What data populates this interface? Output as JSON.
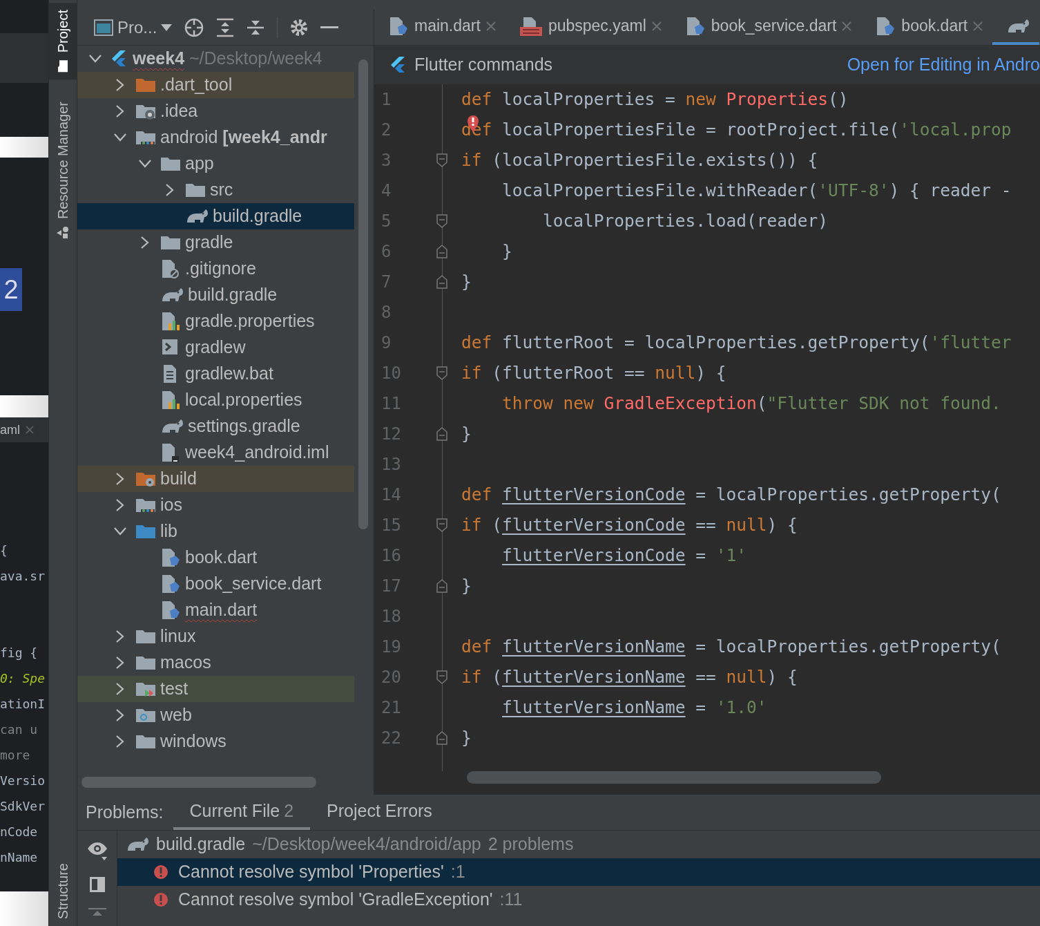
{
  "background_window": {
    "badge": "2",
    "tab": {
      "label": "aml",
      "closable": true
    },
    "code_blocks": [
      [
        {
          "text": "{",
          "kind": "plain"
        },
        {
          "text": "ava.sr",
          "kind": "plain"
        }
      ],
      [
        {
          "text": "fig {",
          "kind": "plain"
        },
        {
          "text": "0: Spe",
          "kind": "todo"
        },
        {
          "text": "ationI",
          "kind": "plain"
        },
        {
          "text": "can u",
          "kind": "comment"
        },
        {
          "text": "more",
          "kind": "comment"
        },
        {
          "text": "Versio",
          "kind": "plain"
        },
        {
          "text": "SdkVer",
          "kind": "plain"
        },
        {
          "text": "nCode",
          "kind": "plain"
        },
        {
          "text": "nName",
          "kind": "plain"
        }
      ]
    ]
  },
  "tool_strip": {
    "items": [
      {
        "label": "Project",
        "kind": "folder",
        "selected": true
      },
      {
        "label": "Resource Manager",
        "kind": "shapes",
        "selected": false
      }
    ],
    "bottom_items": [
      {
        "label": "Structure",
        "selected": false
      }
    ]
  },
  "project_panel": {
    "view_selector": "Pro...",
    "tree": [
      {
        "label": "**week4** ~/Desktop/week4",
        "kind": "flutter",
        "expanded": true,
        "error": true,
        "selected": false,
        "children": [
          {
            "label": ".dart_tool",
            "kind": "folder-orange",
            "expanded": false,
            "color": "#4a463b",
            "selected": false
          },
          {
            "label": ".idea",
            "kind": "folder-gear",
            "expanded": false,
            "selected": false
          },
          {
            "label": "android **[week4_andr**",
            "kind": "folder-module",
            "expanded": true,
            "selected": false,
            "children": [
              {
                "label": "app",
                "kind": "folder",
                "expanded": true,
                "selected": false,
                "children": [
                  {
                    "label": "src",
                    "kind": "folder",
                    "expanded": false,
                    "selected": false
                  },
                  {
                    "label": "build.gradle",
                    "kind": "gradle",
                    "selected": true
                  }
                ]
              },
              {
                "label": "gradle",
                "kind": "folder",
                "expanded": false,
                "selected": false
              },
              {
                "label": ".gitignore",
                "kind": "gitignore",
                "selected": false
              },
              {
                "label": "build.gradle",
                "kind": "gradle",
                "selected": false
              },
              {
                "label": "gradle.properties",
                "kind": "properties",
                "selected": false
              },
              {
                "label": "gradlew",
                "kind": "script",
                "selected": false
              },
              {
                "label": "gradlew.bat",
                "kind": "text",
                "selected": false
              },
              {
                "label": "local.properties",
                "kind": "properties",
                "selected": false
              },
              {
                "label": "settings.gradle",
                "kind": "gradle",
                "selected": false
              },
              {
                "label": "week4_android.iml",
                "kind": "iml",
                "selected": false
              }
            ]
          },
          {
            "label": "build",
            "kind": "folder-orange-gear",
            "expanded": false,
            "color": "#4a463b",
            "selected": false
          },
          {
            "label": "ios",
            "kind": "folder-module",
            "expanded": false,
            "selected": false
          },
          {
            "label": "lib",
            "kind": "folder-blue",
            "expanded": true,
            "selected": false,
            "children": [
              {
                "label": "book.dart",
                "kind": "dart",
                "selected": false
              },
              {
                "label": "book_service.dart",
                "kind": "dart",
                "selected": false
              },
              {
                "label": "main.dart",
                "kind": "dart",
                "error": true,
                "selected": false
              }
            ]
          },
          {
            "label": "linux",
            "kind": "folder",
            "expanded": false,
            "selected": false
          },
          {
            "label": "macos",
            "kind": "folder",
            "expanded": false,
            "selected": false
          },
          {
            "label": "test",
            "kind": "folder-test",
            "expanded": false,
            "color": "#444c3f",
            "selected": false
          },
          {
            "label": "web",
            "kind": "folder-web",
            "expanded": false,
            "selected": false
          },
          {
            "label": "windows",
            "kind": "folder",
            "expanded": false,
            "selected": false
          }
        ]
      }
    ]
  },
  "editor": {
    "tabs": [
      {
        "label": "main.dart",
        "kind": "dart",
        "selected": false
      },
      {
        "label": "pubspec.yaml",
        "kind": "yaml",
        "selected": false
      },
      {
        "label": "book_service.dart",
        "kind": "dart",
        "selected": false
      },
      {
        "label": "book.dart",
        "kind": "dart",
        "selected": false
      },
      {
        "kind": "gradle",
        "selected": true
      }
    ],
    "banner": {
      "title": "Flutter commands",
      "link": "Open for Editing in Andro"
    },
    "lines": [
      {
        "number": "1",
        "tokens": [
          {
            "text": "def",
            "kind": "keyword"
          },
          {
            "text": " localProperties = ",
            "kind": "plain"
          },
          {
            "text": "new ",
            "kind": "keyword"
          },
          {
            "text": "Properties",
            "kind": "unresolved"
          },
          {
            "text": "()",
            "kind": "plain"
          }
        ]
      },
      {
        "number": "2",
        "error": true,
        "tokens": [
          {
            "text": "def",
            "kind": "keyword"
          },
          {
            "text": " localPropertiesFile = rootProject.file(",
            "kind": "plain"
          },
          {
            "text": "'local.prop",
            "kind": "string"
          }
        ]
      },
      {
        "number": "3",
        "fold_start": true,
        "tokens": [
          {
            "text": "if",
            "kind": "keyword"
          },
          {
            "text": " (localPropertiesFile.exists()) {",
            "kind": "plain"
          }
        ]
      },
      {
        "number": "4",
        "tokens": [
          {
            "text": "    localPropertiesFile.withReader(",
            "kind": "plain"
          },
          {
            "text": "'UTF-8'",
            "kind": "string"
          },
          {
            "text": ") { reader -",
            "kind": "plain"
          }
        ]
      },
      {
        "number": "5",
        "fold_start": true,
        "tokens": [
          {
            "text": "        localProperties.load(reader)",
            "kind": "plain"
          }
        ]
      },
      {
        "number": "6",
        "fold_end": true,
        "tokens": [
          {
            "text": "    }",
            "kind": "plain"
          }
        ]
      },
      {
        "number": "7",
        "fold_end": true,
        "tokens": [
          {
            "text": "}",
            "kind": "plain"
          }
        ]
      },
      {
        "number": "8"
      },
      {
        "number": "9",
        "tokens": [
          {
            "text": "def",
            "kind": "keyword"
          },
          {
            "text": " flutterRoot = localProperties.getProperty(",
            "kind": "plain"
          },
          {
            "text": "'flutter",
            "kind": "string"
          }
        ]
      },
      {
        "number": "10",
        "fold_start": true,
        "tokens": [
          {
            "text": "if",
            "kind": "keyword"
          },
          {
            "text": " (flutterRoot == ",
            "kind": "plain"
          },
          {
            "text": "null",
            "kind": "keyword"
          },
          {
            "text": ") {",
            "kind": "plain"
          }
        ]
      },
      {
        "number": "11",
        "tokens": [
          {
            "text": "    throw new ",
            "kind": "keyword"
          },
          {
            "text": "GradleException",
            "kind": "unresolved"
          },
          {
            "text": "(",
            "kind": "plain"
          },
          {
            "text": "\"Flutter SDK not found.",
            "kind": "string"
          }
        ]
      },
      {
        "number": "12",
        "fold_end": true,
        "tokens": [
          {
            "text": "}",
            "kind": "plain"
          }
        ]
      },
      {
        "number": "13"
      },
      {
        "number": "14",
        "tokens": [
          {
            "text": "def ",
            "kind": "keyword"
          },
          {
            "text": "flutterVersionCode",
            "kind": "field"
          },
          {
            "text": " = localProperties.getProperty(",
            "kind": "plain"
          }
        ]
      },
      {
        "number": "15",
        "fold_start": true,
        "tokens": [
          {
            "text": "if",
            "kind": "keyword"
          },
          {
            "text": " (",
            "kind": "plain"
          },
          {
            "text": "flutterVersionCode",
            "kind": "field"
          },
          {
            "text": " == ",
            "kind": "plain"
          },
          {
            "text": "null",
            "kind": "keyword"
          },
          {
            "text": ") {",
            "kind": "plain"
          }
        ]
      },
      {
        "number": "16",
        "tokens": [
          {
            "text": "    flutterVersionCode",
            "kind": "field"
          },
          {
            "text": " = ",
            "kind": "plain"
          },
          {
            "text": "'1'",
            "kind": "string"
          }
        ]
      },
      {
        "number": "17",
        "fold_end": true,
        "tokens": [
          {
            "text": "}",
            "kind": "plain"
          }
        ]
      },
      {
        "number": "18"
      },
      {
        "number": "19",
        "tokens": [
          {
            "text": "def ",
            "kind": "keyword"
          },
          {
            "text": "flutterVersionName",
            "kind": "field"
          },
          {
            "text": " = localProperties.getProperty(",
            "kind": "plain"
          }
        ]
      },
      {
        "number": "20",
        "fold_start": true,
        "tokens": [
          {
            "text": "if",
            "kind": "keyword"
          },
          {
            "text": " (",
            "kind": "plain"
          },
          {
            "text": "flutterVersionName",
            "kind": "field"
          },
          {
            "text": " == ",
            "kind": "plain"
          },
          {
            "text": "null",
            "kind": "keyword"
          },
          {
            "text": ") {",
            "kind": "plain"
          }
        ]
      },
      {
        "number": "21",
        "tokens": [
          {
            "text": "    flutterVersionName",
            "kind": "field"
          },
          {
            "text": " = ",
            "kind": "plain"
          },
          {
            "text": "'1.0'",
            "kind": "string"
          }
        ]
      },
      {
        "number": "22",
        "fold_end": true,
        "tokens": [
          {
            "text": "}",
            "kind": "plain"
          }
        ]
      }
    ]
  },
  "problems": {
    "title": "Problems:",
    "tabs": [
      {
        "label": "Current File",
        "count": "2",
        "selected": true
      },
      {
        "label": "Project Errors",
        "selected": false
      }
    ],
    "file": {
      "name": "build.gradle",
      "path": "~/Desktop/week4/android/app",
      "summary": "2 problems"
    },
    "items": [
      {
        "message": "Cannot resolve symbol 'Properties'",
        "line": ":1",
        "selected": true
      },
      {
        "message": "Cannot resolve symbol 'GradleException'",
        "line": ":11",
        "selected": false
      }
    ]
  }
}
